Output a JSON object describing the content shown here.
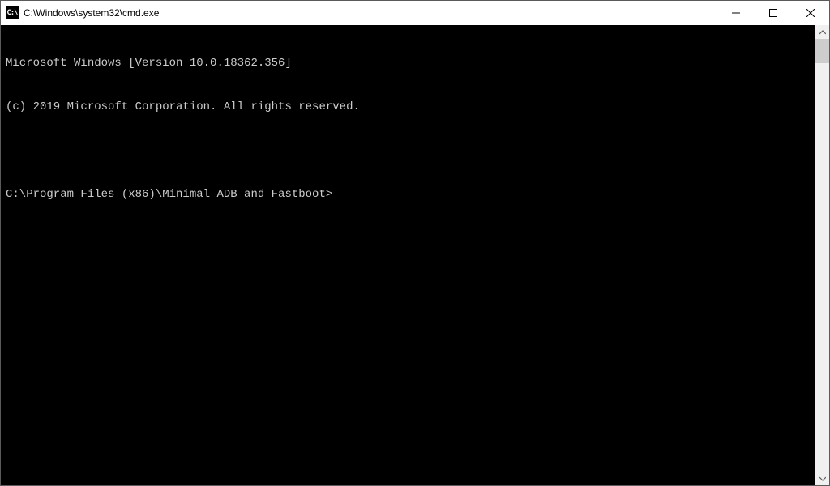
{
  "window": {
    "title": "C:\\Windows\\system32\\cmd.exe",
    "icon_glyph": "C:\\"
  },
  "terminal": {
    "lines": [
      "Microsoft Windows [Version 10.0.18362.356]",
      "(c) 2019 Microsoft Corporation. All rights reserved."
    ],
    "prompt": "C:\\Program Files (x86)\\Minimal ADB and Fastboot>",
    "input_value": ""
  }
}
